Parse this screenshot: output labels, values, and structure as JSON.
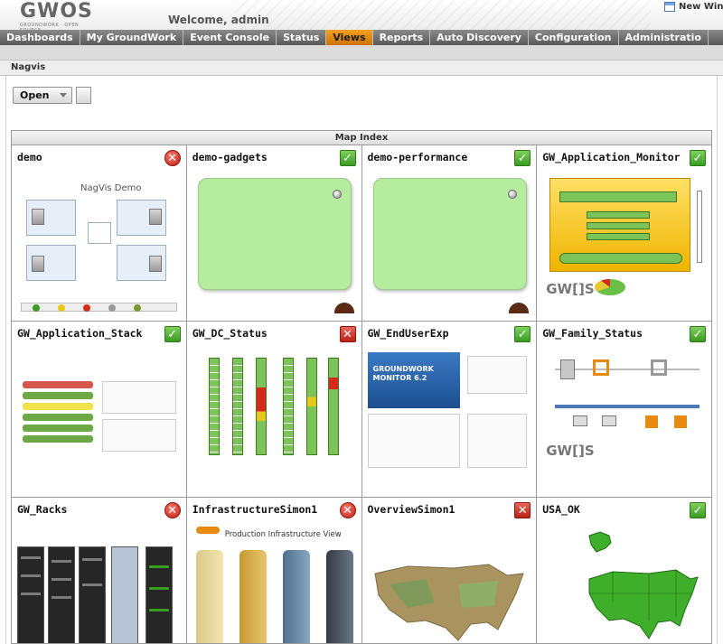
{
  "header": {
    "logo_text": "GWOS",
    "logo_sub": "GROUNDWORK · OPEN SOURCE",
    "welcome": "Welcome, admin",
    "new_window": "New Wind"
  },
  "nav": {
    "tabs": [
      {
        "label": "Dashboards",
        "active": false
      },
      {
        "label": "My GroundWork",
        "active": false
      },
      {
        "label": "Event Console",
        "active": false
      },
      {
        "label": "Status",
        "active": false
      },
      {
        "label": "Views",
        "active": true
      },
      {
        "label": "Reports",
        "active": false
      },
      {
        "label": "Auto Discovery",
        "active": false
      },
      {
        "label": "Configuration",
        "active": false
      },
      {
        "label": "Administratio",
        "active": false
      }
    ]
  },
  "section": {
    "title": "Nagvis"
  },
  "toolbar": {
    "open_label": "Open"
  },
  "map_index": {
    "title": "Map Index",
    "maps": [
      {
        "name": "demo",
        "status": "error-round",
        "thumb_text": "NagVis Demo"
      },
      {
        "name": "demo-gadgets",
        "status": "ok"
      },
      {
        "name": "demo-performance",
        "status": "ok"
      },
      {
        "name": "GW_Application_Monitor",
        "status": "ok",
        "thumb_text": "GW[]S"
      },
      {
        "name": "GW_Application_Stack",
        "status": "ok"
      },
      {
        "name": "GW_DC_Status",
        "status": "error-square"
      },
      {
        "name": "GW_EndUserExp",
        "status": "ok",
        "thumb_text": "GROUNDWORK MONITOR 6.2"
      },
      {
        "name": "GW_Family_Status",
        "status": "ok",
        "thumb_text": "GW[]S"
      },
      {
        "name": "GW_Racks",
        "status": "error-round"
      },
      {
        "name": "InfrastructureSimon1",
        "status": "error-round",
        "thumb_text": "Production Infrastructure View"
      },
      {
        "name": "OverviewSimon1",
        "status": "error-square"
      },
      {
        "name": "USA_OK",
        "status": "ok"
      }
    ]
  },
  "colors": {
    "nav_active": "#e98a10",
    "ok_green": "#4caf2e",
    "error_red": "#d4291b",
    "gadget_green": "#b5ec9e"
  },
  "icons": {
    "ok": "check-icon",
    "error": "cross-icon"
  }
}
